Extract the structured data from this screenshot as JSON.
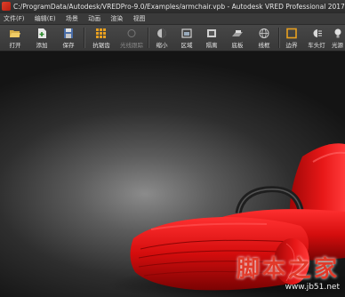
{
  "window": {
    "title": "C:/ProgramData/Autodesk/VREDPro-9.0/Examples/armchair.vpb - Autodesk VRED Professional 2017"
  },
  "menu": [
    "文件(F)",
    "编辑(E)",
    "场景",
    "动画",
    "渲染",
    "视图"
  ],
  "toolbar": {
    "open": "打开",
    "add": "添加",
    "save": "保存",
    "raytracing": "抗锯齿",
    "realtime": "光线跟踪",
    "zoom": "缩小",
    "region": "区域",
    "hide": "隔离",
    "floor": "底板",
    "wireframe": "线框",
    "border": "边界",
    "headlight": "车头灯",
    "lights": "光源"
  },
  "watermark": {
    "title": "脚本之家",
    "url": "www.jb51.net"
  }
}
